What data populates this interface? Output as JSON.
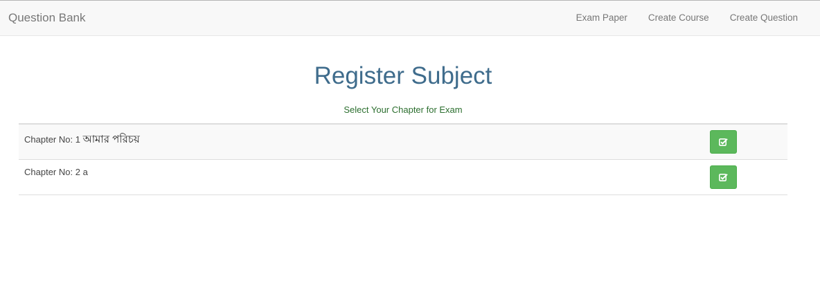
{
  "navbar": {
    "brand": "Question Bank",
    "links": [
      {
        "label": "Exam Paper"
      },
      {
        "label": "Create Course"
      },
      {
        "label": "Create Question"
      }
    ]
  },
  "page": {
    "title": "Register Subject",
    "subtitle": "Select Your Chapter for Exam"
  },
  "chapters": [
    {
      "prefix": "Chapter No: 1",
      "name": "আমার পরিচয়",
      "icon": "check-square-icon"
    },
    {
      "prefix": "Chapter No: 2",
      "name": "a",
      "icon": "check-square-icon"
    }
  ],
  "colors": {
    "accent": "#3f6c8c",
    "subtitle": "#2b6e2e",
    "button": "#5cb85c"
  }
}
